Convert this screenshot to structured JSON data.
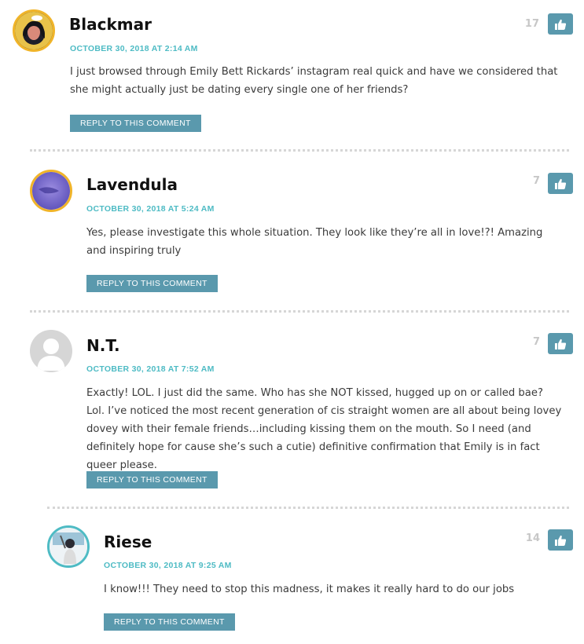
{
  "comments": [
    {
      "author": "Blackmar",
      "date": "OCTOBER 30, 2018 AT 2:14 AM",
      "likes": "17",
      "text": "I just browsed through Emily Bett Rickards’ instagram real quick and have we considered that she might actually just be dating every single one of her friends?",
      "reply": "REPLY TO THIS COMMENT"
    },
    {
      "author": "Lavendula",
      "date": "OCTOBER 30, 2018 AT 5:24 AM",
      "likes": "7",
      "text": "Yes, please investigate this whole situation. They look like they’re all in love!?! Amazing and inspiring truly",
      "reply": "REPLY TO THIS COMMENT"
    },
    {
      "author": "N.T.",
      "date": "OCTOBER 30, 2018 AT 7:52 AM",
      "likes": "7",
      "text": "Exactly! LOL. I just did the same. Who has she NOT kissed, hugged up on or called bae? Lol. I’ve noticed the most recent generation of cis straight women are all about being lovey dovey with their female friends…including kissing them on the mouth. So I need (and definitely hope for cause she’s such a cutie) definitive confirmation that Emily is in fact queer please.",
      "reply": "REPLY TO THIS COMMENT"
    },
    {
      "author": "Riese",
      "date": "OCTOBER 30, 2018 AT 9:25 AM",
      "likes": "14",
      "text": "I know!!! They need to stop this madness, it makes it really hard to do our jobs",
      "reply": "REPLY TO THIS COMMENT"
    }
  ],
  "icons": {
    "like": "thumbs-up-icon",
    "avatar_default": "default-user-icon"
  },
  "colors": {
    "accent": "#4ebbc4",
    "button": "#5a99ad",
    "avatar_ring_gold": "#f0b429",
    "avatar_ring_teal": "#4ebbc4"
  }
}
